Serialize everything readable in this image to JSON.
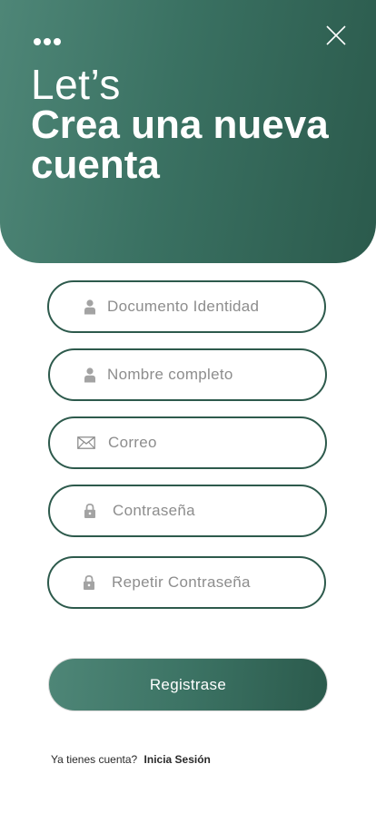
{
  "header": {
    "title_light": "Let’s",
    "title_bold": "Crea una nueva cuenta",
    "menu_icon": "more-dots-icon",
    "close_icon": "close-icon"
  },
  "form": {
    "fields": [
      {
        "placeholder": "Documento Identidad",
        "icon": "user-icon"
      },
      {
        "placeholder": "Nombre completo",
        "icon": "user-icon"
      },
      {
        "placeholder": "Correo",
        "icon": "mail-icon"
      },
      {
        "placeholder": "Contraseña",
        "icon": "lock-icon"
      },
      {
        "placeholder": "Repetir Contraseña",
        "icon": "lock-icon"
      }
    ],
    "submit_label": "Registrase"
  },
  "footer": {
    "prompt": "Ya tienes cuenta?",
    "login_link": "Inicia Sesión"
  },
  "colors": {
    "primary": "#2d5a4c",
    "primary_light": "#4e8677",
    "icon_gray": "#a3a3a3"
  }
}
